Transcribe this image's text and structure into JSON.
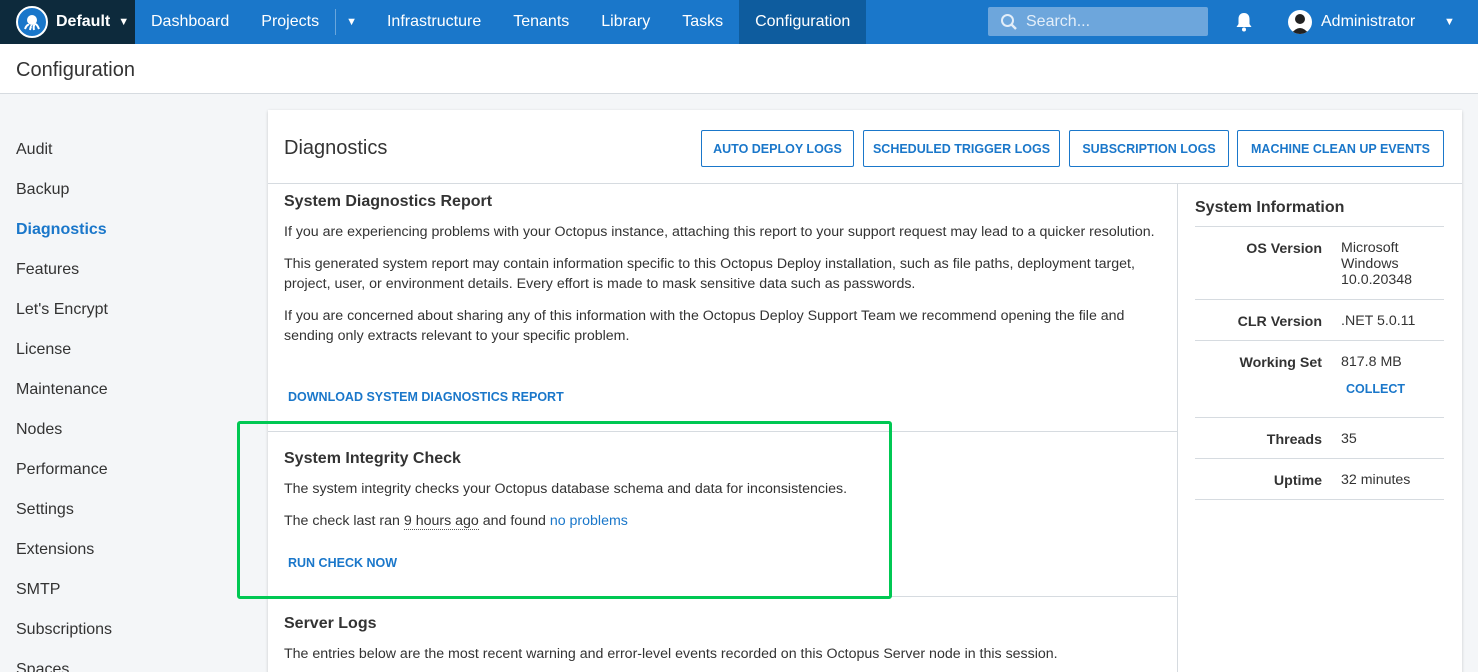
{
  "topnav": {
    "space": "Default",
    "items": [
      "Dashboard",
      "Projects",
      "Infrastructure",
      "Tenants",
      "Library",
      "Tasks",
      "Configuration"
    ],
    "search_placeholder": "Search...",
    "user": "Administrator"
  },
  "page": {
    "title": "Configuration"
  },
  "sidebar": {
    "items": [
      "Audit",
      "Backup",
      "Diagnostics",
      "Features",
      "Let's Encrypt",
      "License",
      "Maintenance",
      "Nodes",
      "Performance",
      "Settings",
      "Extensions",
      "SMTP",
      "Subscriptions",
      "Spaces"
    ],
    "active": "Diagnostics"
  },
  "diagnostics": {
    "title": "Diagnostics",
    "buttons": [
      "AUTO DEPLOY LOGS",
      "SCHEDULED TRIGGER LOGS",
      "SUBSCRIPTION LOGS",
      "MACHINE CLEAN UP EVENTS"
    ],
    "report": {
      "title": "System Diagnostics Report",
      "p1": "If you are experiencing problems with your Octopus instance, attaching this report to your support request may lead to a quicker resolution.",
      "p2": "This generated system report may contain information specific to this Octopus Deploy installation, such as file paths, deployment target, project, user, or environment details. Every effort is made to mask sensitive data such as passwords.",
      "p3": "If you are concerned about sharing any of this information with the Octopus Deploy Support Team we recommend opening the file and sending only extracts relevant to your specific problem.",
      "download": "DOWNLOAD SYSTEM DIAGNOSTICS REPORT"
    },
    "integrity": {
      "title": "System Integrity Check",
      "p1": "The system integrity checks your Octopus database schema and data for inconsistencies.",
      "p2_prefix": "The check last ran ",
      "p2_time": "9 hours ago",
      "p2_mid": " and found ",
      "p2_result": "no problems",
      "run": "RUN CHECK NOW"
    },
    "server_logs": {
      "title": "Server Logs",
      "p1": "The entries below are the most recent warning and error-level events recorded on this Octopus Server node in this session."
    }
  },
  "system_info": {
    "title": "System Information",
    "os_label": "OS Version",
    "os_value": "Microsoft Windows 10.0.20348",
    "clr_label": "CLR Version",
    "clr_value": ".NET 5.0.11",
    "ws_label": "Working Set",
    "ws_value": "817.8 MB",
    "collect": "COLLECT",
    "threads_label": "Threads",
    "threads_value": "35",
    "uptime_label": "Uptime",
    "uptime_value": "32 minutes"
  },
  "colors": {
    "nav_blue": "#1a77ca",
    "space_bg": "#0d2a3c",
    "highlight": "#00c853"
  },
  "icons": [
    "octopus-logo-icon",
    "search-icon",
    "bell-icon",
    "user-avatar-icon",
    "chevron-down-icon"
  ]
}
